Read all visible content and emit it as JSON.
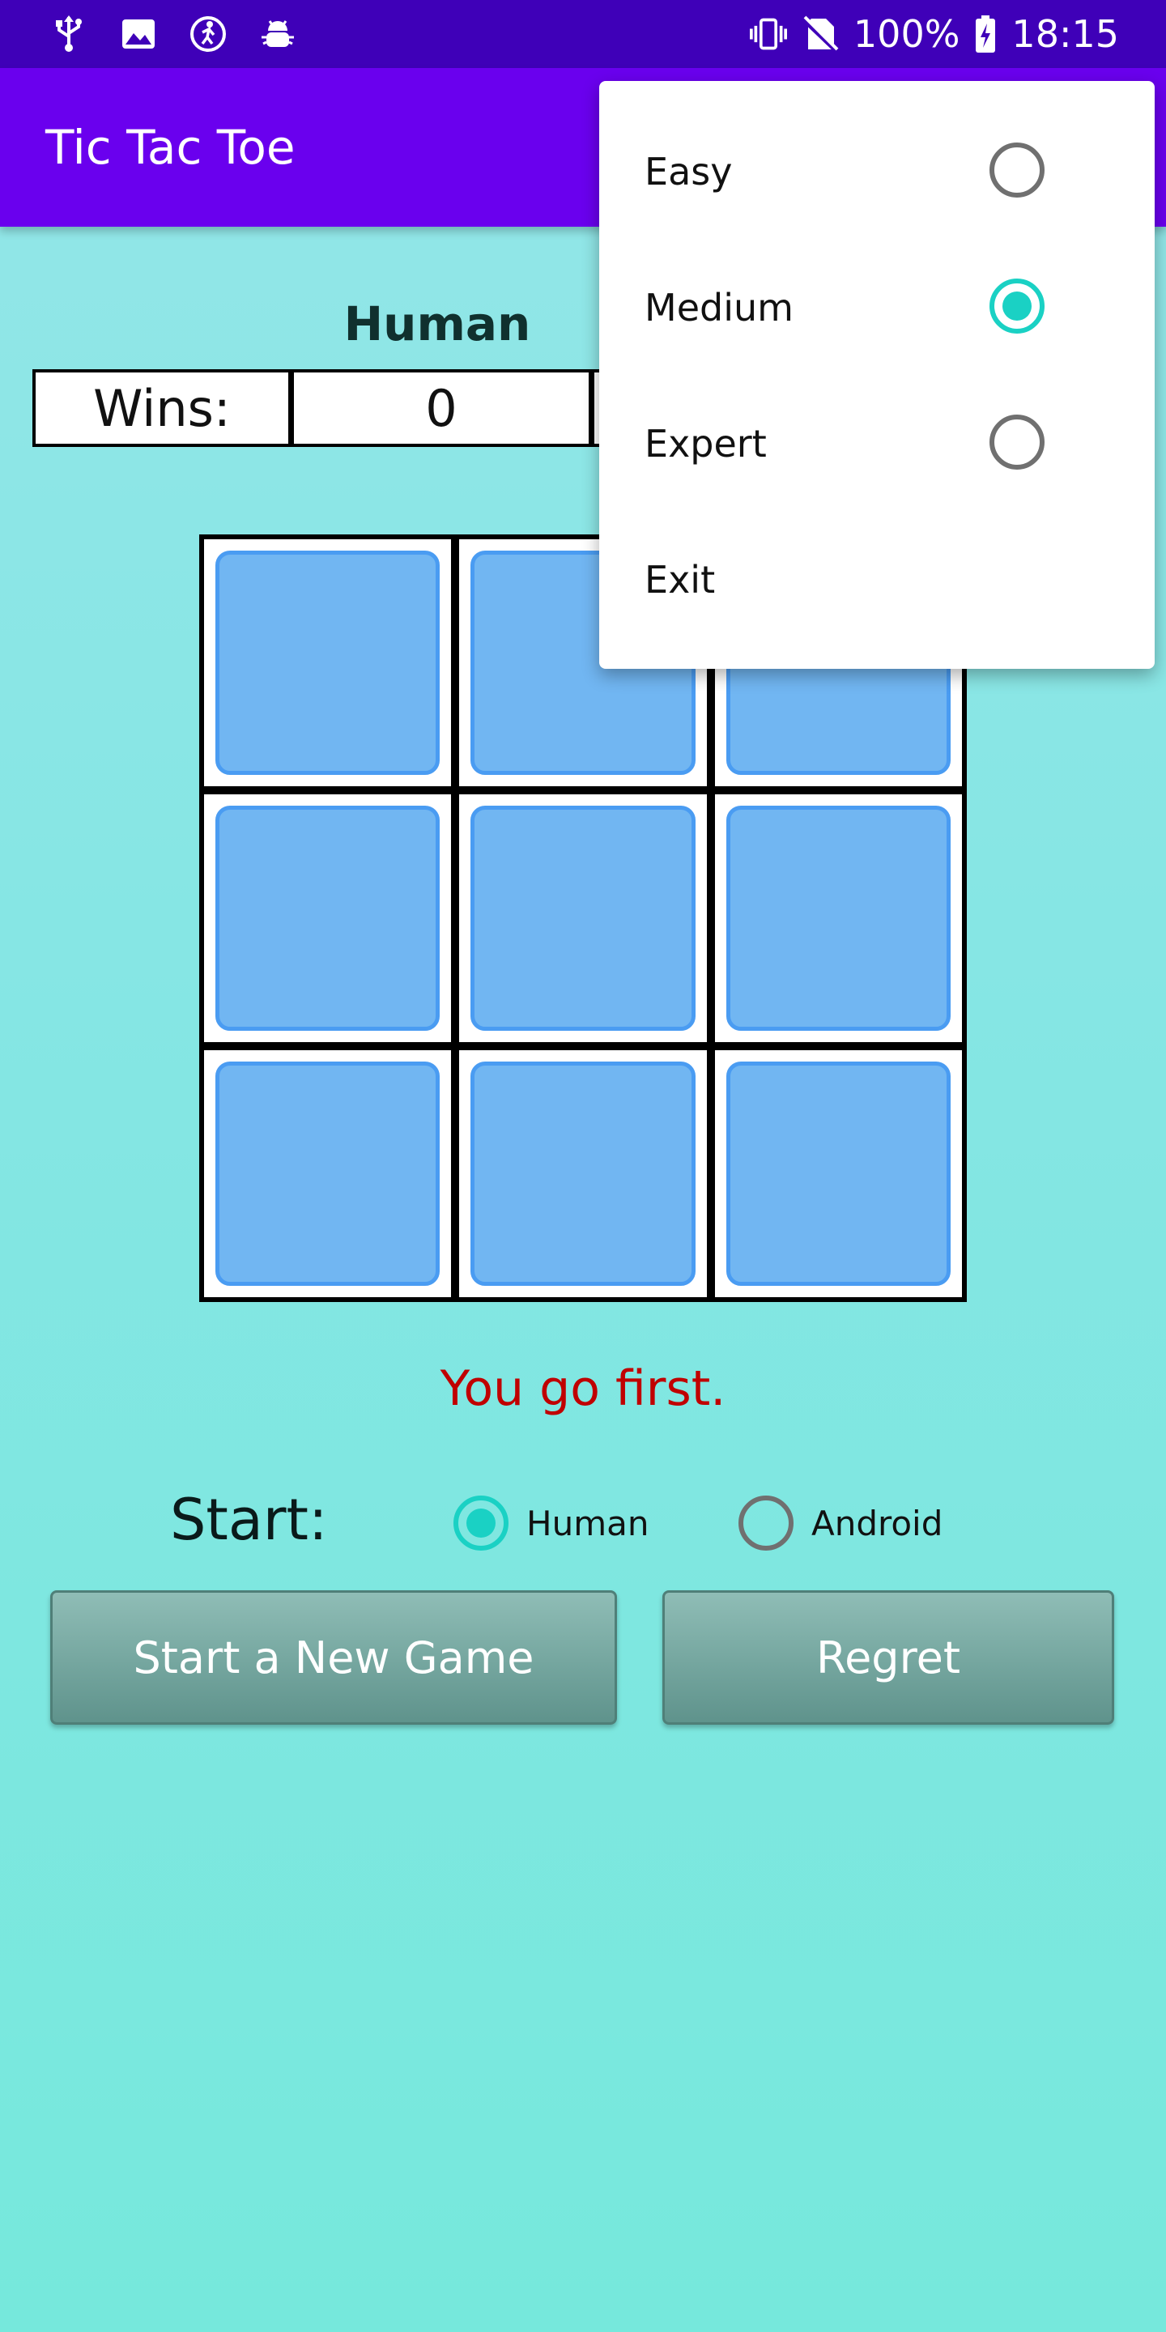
{
  "status_bar": {
    "battery": "100%",
    "time": "18:15",
    "left_icons": [
      "usb-icon",
      "image-icon",
      "accessibility-icon",
      "android-debug-icon"
    ],
    "right_icons": [
      "vibrate-icon",
      "no-sim-icon",
      "battery-charging-icon"
    ]
  },
  "app_bar": {
    "title": "Tic Tac Toe"
  },
  "score": {
    "player": "Human",
    "wins_label": "Wins:",
    "wins_value": "0"
  },
  "board": {
    "cells": [
      "",
      "",
      "",
      "",
      "",
      "",
      "",
      "",
      ""
    ]
  },
  "message": "You go first.",
  "start": {
    "label": "Start:",
    "options": [
      {
        "label": "Human",
        "selected": true
      },
      {
        "label": "Android",
        "selected": false
      }
    ]
  },
  "buttons": {
    "new_game": "Start a New Game",
    "regret": "Regret"
  },
  "menu": {
    "items": [
      {
        "label": "Easy",
        "checked": false
      },
      {
        "label": "Medium",
        "checked": true
      },
      {
        "label": "Expert",
        "checked": false
      },
      {
        "label": "Exit"
      }
    ]
  },
  "colors": {
    "status_bar": "#3f00b8",
    "app_bar": "#6a00ee",
    "accent": "#1ad1c4",
    "cell_fill": "#71b6f2",
    "message": "#c00000"
  }
}
